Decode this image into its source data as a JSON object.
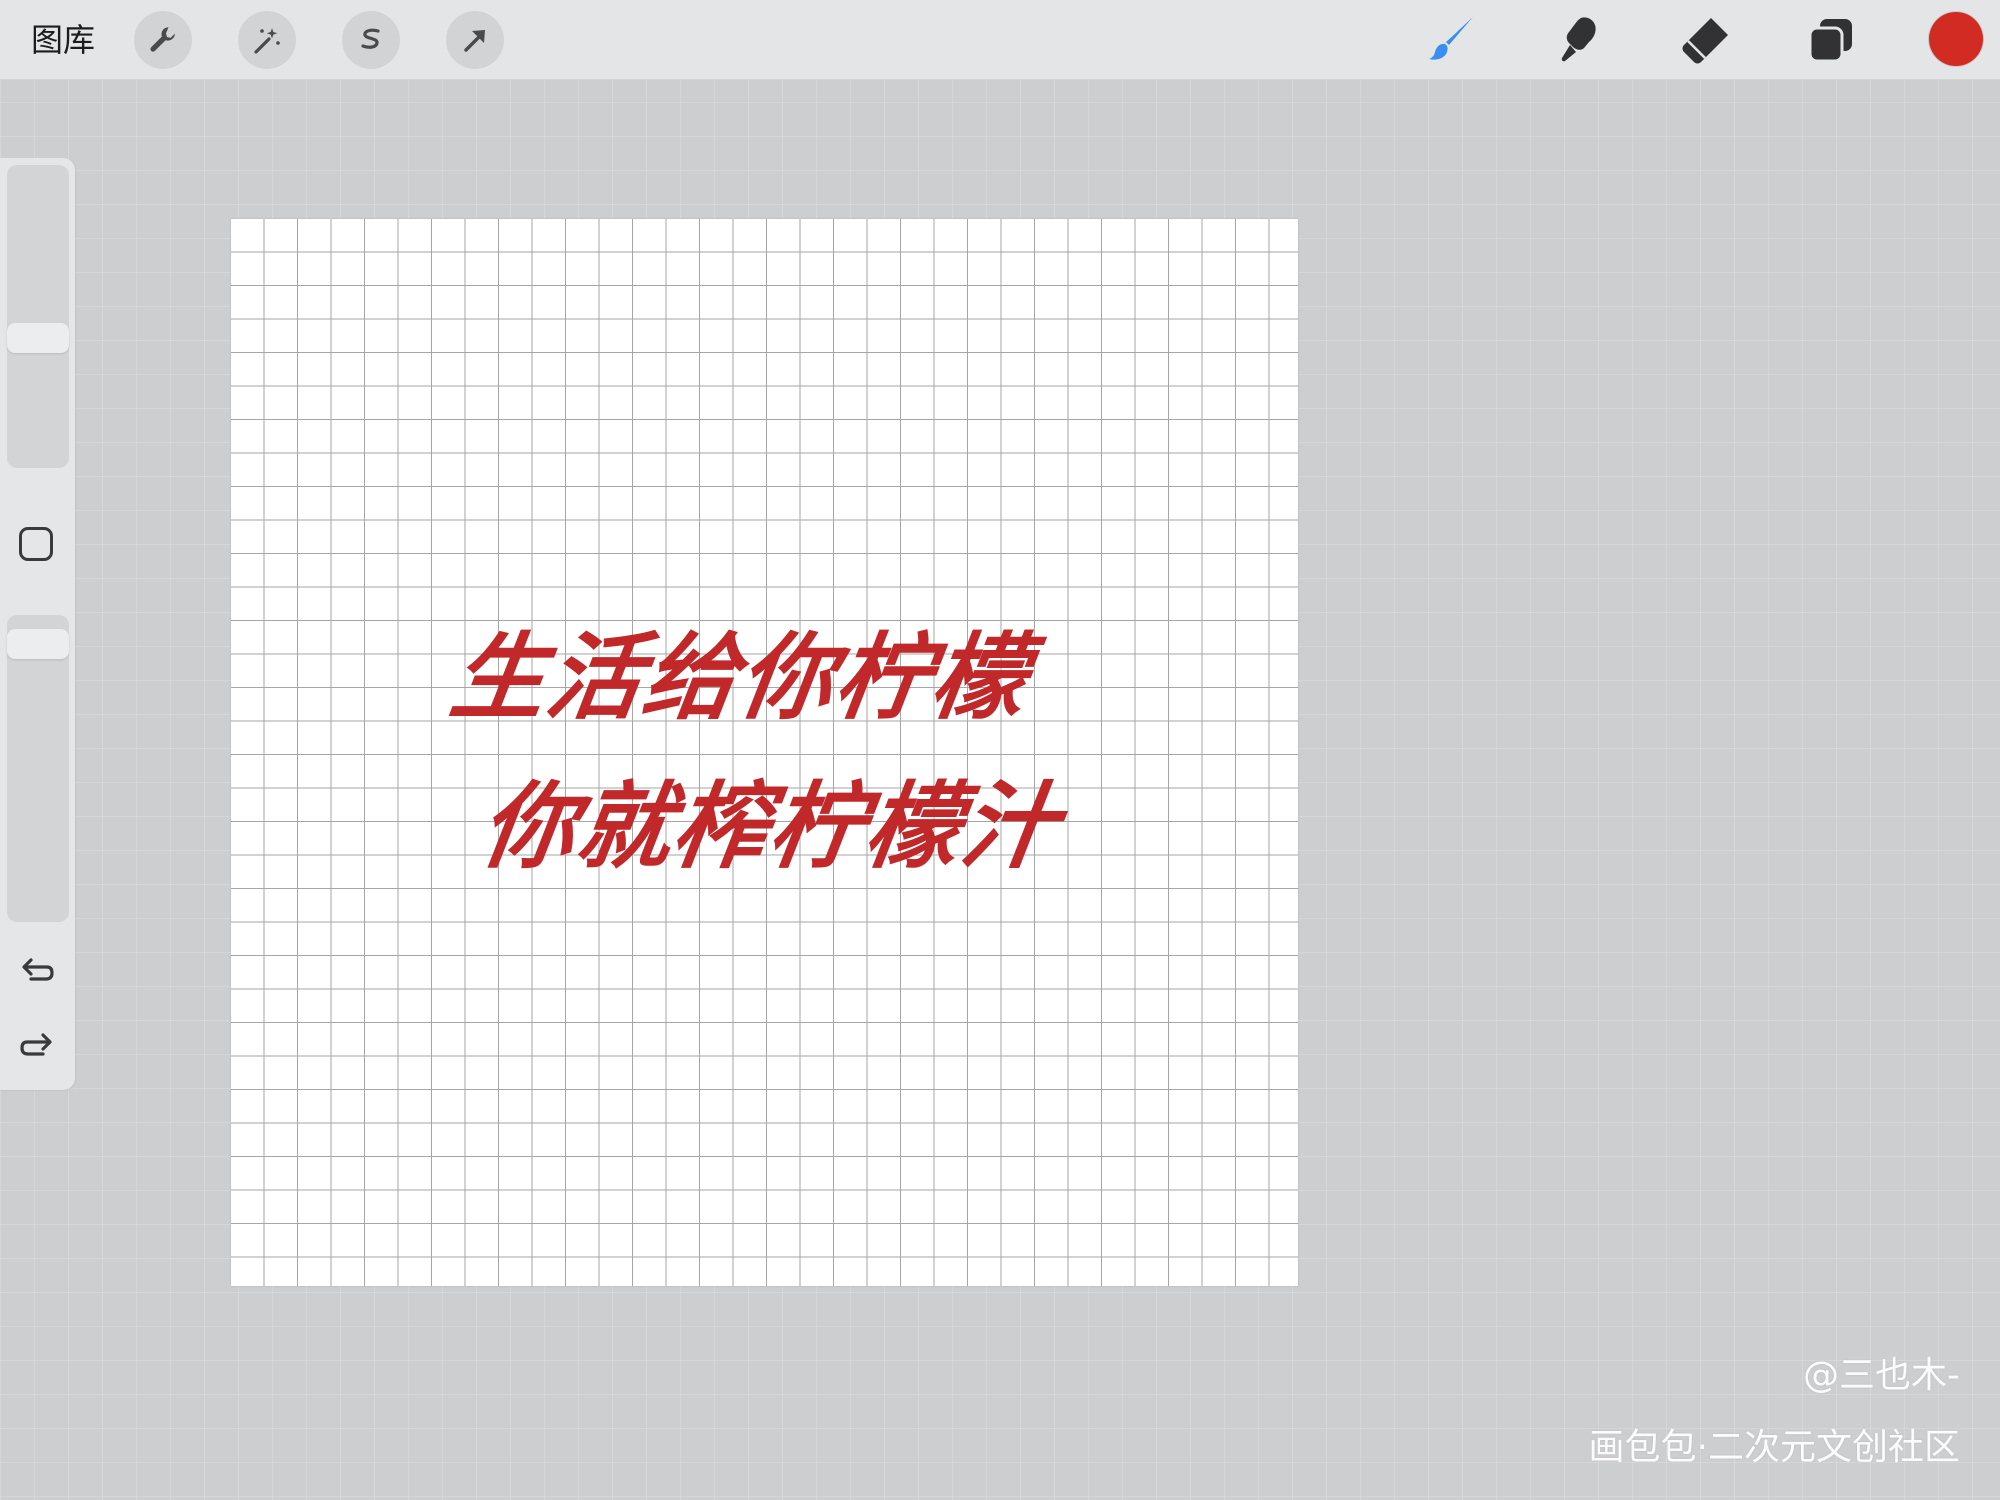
{
  "toolbar": {
    "gallery_label": "图库",
    "left_tools": [
      "wrench-icon",
      "magic-wand-icon",
      "selection-icon",
      "transform-arrow-icon"
    ],
    "right_tools": [
      "brush-icon",
      "smudge-icon",
      "eraser-icon",
      "layers-icon"
    ],
    "active_tool": "brush-icon",
    "active_color": "#d12b23",
    "accent_color": "#3a8ef0"
  },
  "sidebar": {
    "brush_size_level": 0.42,
    "opacity_level": 0.95,
    "buttons": [
      "modify-square",
      "undo-icon",
      "redo-icon"
    ]
  },
  "canvas": {
    "grid": true,
    "ink_color": "#c0282a",
    "lines": [
      "生活给你柠檬",
      "你就榨柠檬汁"
    ]
  },
  "watermark": {
    "author": "@三也木-",
    "site": "画包包·二次元文创社区"
  }
}
